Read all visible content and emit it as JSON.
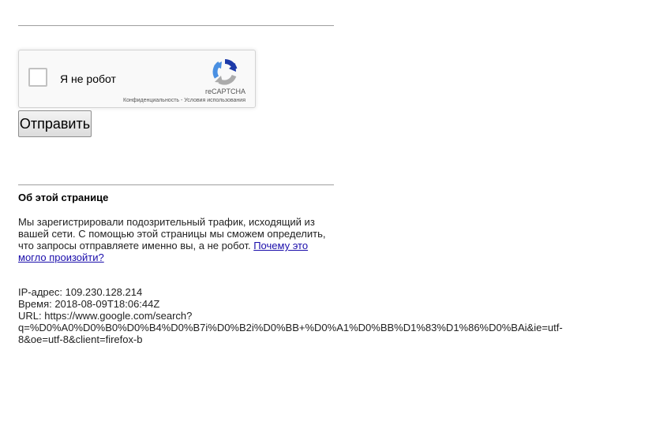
{
  "recaptcha": {
    "checkbox_label": "Я не робот",
    "brand": "reCAPTCHA",
    "privacy_link": "Конфиденциальность",
    "separator": " - ",
    "terms_link": "Условия использования"
  },
  "form": {
    "submit_label": "Отправить"
  },
  "about": {
    "title": "Об этой странице",
    "text_part1": "Мы зарегистрировали подозрительный трафик, исходящий из вашей сети. С помощью этой страницы мы сможем определить, что запросы отправляете именно вы, а не робот. ",
    "link_text": "Почему это могло произойти?"
  },
  "info": {
    "ip": "IP-адрес: 109.230.128.214",
    "time": "Время: 2018-08-09T18:06:44Z",
    "url_line1": "URL: https://www.google.com/search?",
    "url_line2": "q=%D0%A0%D0%B0%D0%B4%D0%B7i%D0%B2i%D0%BB+%D0%A1%D0%BB%D1%83%D1%86%D0%BAi&ie=utf-",
    "url_line3": "8&oe=utf-8&client=firefox-b"
  },
  "colors": {
    "link": "#1a0dab",
    "recaptcha_blue": "#1c3aa9",
    "recaptcha_lightblue": "#4a90e2",
    "recaptcha_gray": "#ababab"
  }
}
